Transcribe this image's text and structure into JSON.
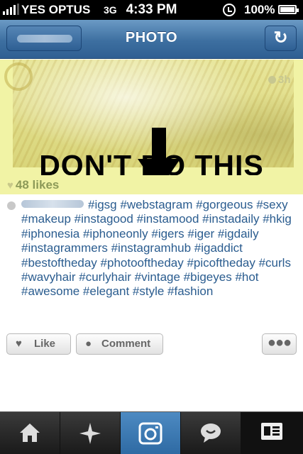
{
  "status_bar": {
    "carrier": "YES OPTUS",
    "network": "3G",
    "time": "4:33 PM",
    "battery": "100%"
  },
  "nav": {
    "title": "PHOTO",
    "refresh_icon": "refresh-icon"
  },
  "post": {
    "time_ago": "3h",
    "overlay_text": "DON'T DO THIS",
    "likes": "48 likes",
    "caption_hashtags": "#igsg #webstagram #gorgeous #sexy #makeup #instagood #instamood #instadaily #hkig #iphonesia #iphoneonly #igers #iger #igdaily #instagrammers #instagramhub #igaddict #bestoftheday #photooftheday #picoftheday #curls #wavyhair #curlyhair #vintage #bigeyes #hot #awesome #elegant #style #fashion"
  },
  "actions": {
    "like_label": "Like",
    "comment_label": "Comment",
    "more_label": "●●●"
  },
  "tabbar": {
    "items": [
      {
        "name": "home",
        "icon": "home-icon"
      },
      {
        "name": "explore",
        "icon": "star-icon"
      },
      {
        "name": "camera",
        "icon": "camera-icon"
      },
      {
        "name": "activity",
        "icon": "speech-bubble-icon"
      },
      {
        "name": "profile",
        "icon": "profile-card-icon"
      }
    ]
  },
  "colors": {
    "nav_blue": "#3d6fa0",
    "highlight_yellow": "#f1f3a5",
    "hashtag_blue": "#2a5c8f",
    "likes_green": "#8d9a58"
  }
}
